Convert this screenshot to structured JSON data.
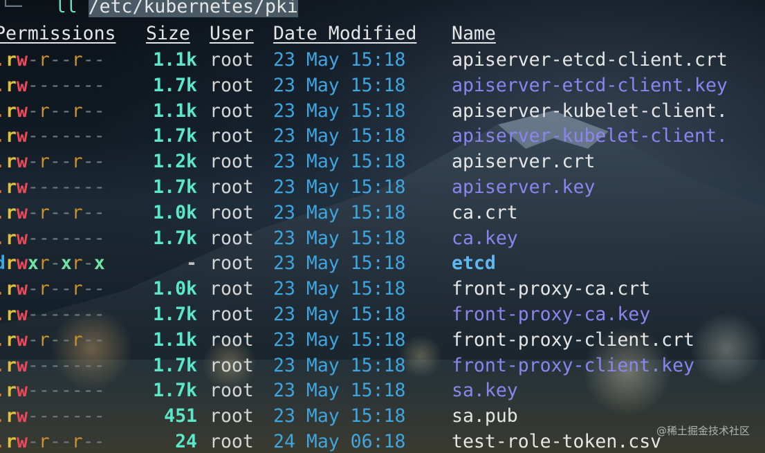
{
  "prompt": {
    "mark": "└─",
    "command": "ll",
    "path": "/etc/kubernetes/pki"
  },
  "headers": {
    "permissions": "Permissions",
    "size": "Size",
    "user": "User",
    "date_modified": "Date Modified",
    "name": "Name"
  },
  "files": [
    {
      "perm": ".rw-r--r--",
      "size": "1.1k",
      "user": "root",
      "date": "23 May 15:18",
      "name": "apiserver-etcd-client.crt",
      "kind": "file"
    },
    {
      "perm": ".rw-------",
      "size": "1.7k",
      "user": "root",
      "date": "23 May 15:18",
      "name": "apiserver-etcd-client.key",
      "kind": "key"
    },
    {
      "perm": ".rw-r--r--",
      "size": "1.1k",
      "user": "root",
      "date": "23 May 15:18",
      "name": "apiserver-kubelet-client.",
      "kind": "file"
    },
    {
      "perm": ".rw-------",
      "size": "1.7k",
      "user": "root",
      "date": "23 May 15:18",
      "name": "apiserver-kubelet-client.",
      "kind": "key"
    },
    {
      "perm": ".rw-r--r--",
      "size": "1.2k",
      "user": "root",
      "date": "23 May 15:18",
      "name": "apiserver.crt",
      "kind": "file"
    },
    {
      "perm": ".rw-------",
      "size": "1.7k",
      "user": "root",
      "date": "23 May 15:18",
      "name": "apiserver.key",
      "kind": "key"
    },
    {
      "perm": ".rw-r--r--",
      "size": "1.0k",
      "user": "root",
      "date": "23 May 15:18",
      "name": "ca.crt",
      "kind": "file"
    },
    {
      "perm": ".rw-------",
      "size": "1.7k",
      "user": "root",
      "date": "23 May 15:18",
      "name": "ca.key",
      "kind": "key"
    },
    {
      "perm": "drwxr-xr-x",
      "size": "-",
      "user": "root",
      "date": "23 May 15:18",
      "name": "etcd",
      "kind": "dir"
    },
    {
      "perm": ".rw-r--r--",
      "size": "1.0k",
      "user": "root",
      "date": "23 May 15:18",
      "name": "front-proxy-ca.crt",
      "kind": "file"
    },
    {
      "perm": ".rw-------",
      "size": "1.7k",
      "user": "root",
      "date": "23 May 15:18",
      "name": "front-proxy-ca.key",
      "kind": "key"
    },
    {
      "perm": ".rw-r--r--",
      "size": "1.1k",
      "user": "root",
      "date": "23 May 15:18",
      "name": "front-proxy-client.crt",
      "kind": "file"
    },
    {
      "perm": ".rw-------",
      "size": "1.7k",
      "user": "root",
      "date": "23 May 15:18",
      "name": "front-proxy-client.key",
      "kind": "key"
    },
    {
      "perm": ".rw-------",
      "size": "1.7k",
      "user": "root",
      "date": "23 May 15:18",
      "name": "sa.key",
      "kind": "key"
    },
    {
      "perm": ".rw-------",
      "size": "451",
      "user": "root",
      "date": "23 May 15:18",
      "name": "sa.pub",
      "kind": "file"
    },
    {
      "perm": ".rw-r--r--",
      "size": "24",
      "user": "root",
      "date": "24 May 06:18",
      "name": "test-role-token.csv",
      "kind": "file"
    }
  ],
  "watermark": "@稀土掘金技术社区",
  "colors": {
    "size": "#5ae8c8",
    "date": "#3fa6e0",
    "key_name": "#8a86f0",
    "dir_name": "#5fb8f0",
    "perm_write": "#ea4a5a",
    "perm_read": "#e0c040",
    "perm_exec": "#6fe3a0"
  }
}
